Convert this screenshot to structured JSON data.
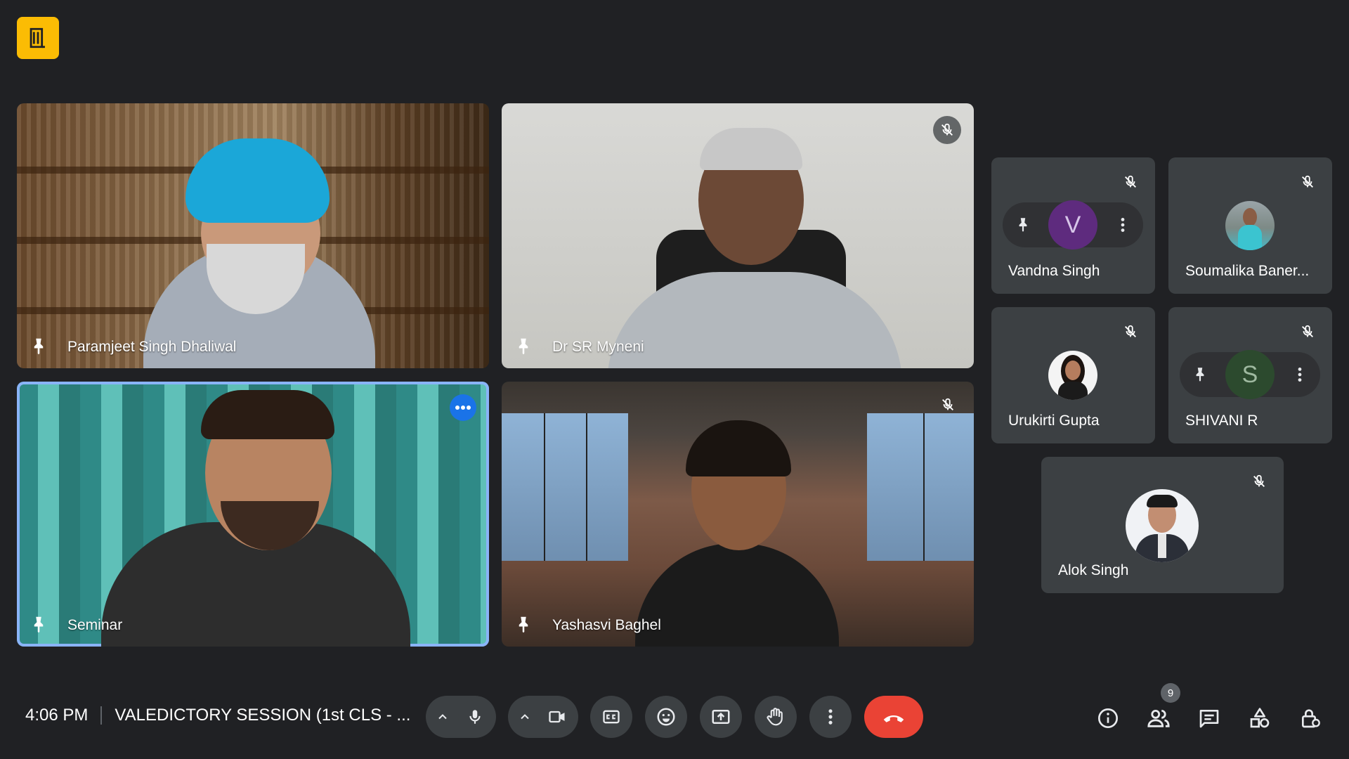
{
  "participants_main": [
    {
      "name": "Paramjeet Singh Dhaliwal"
    },
    {
      "name": "Dr SR Myneni"
    },
    {
      "name": "Seminar"
    },
    {
      "name": "Yashasvi Baghel"
    }
  ],
  "participants_side": [
    {
      "name": "Vandna Singh",
      "initial": "V"
    },
    {
      "name": "Soumalika Baner..."
    },
    {
      "name": "Urukirti Gupta"
    },
    {
      "name": "SHIVANI R",
      "initial": "S"
    },
    {
      "name": "Alok Singh"
    }
  ],
  "footer": {
    "time": "4:06 PM",
    "meeting_title": "VALEDICTORY SESSION (1st CLS - ...",
    "participant_count": "9"
  },
  "colors": {
    "background": "#202124",
    "tile": "#3c4043",
    "end_call": "#ea4335",
    "active_speaker": "#8ab4f8",
    "logo": "#fbbc04",
    "menu_dot": "#1a73e8"
  },
  "icons": [
    "exit-door-icon",
    "microphone-off-icon",
    "pin-icon",
    "more-vert-icon",
    "chevron-up-icon",
    "microphone-icon",
    "camera-icon",
    "captions-icon",
    "emoji-icon",
    "present-icon",
    "raise-hand-icon",
    "end-call-icon",
    "info-icon",
    "people-icon",
    "chat-icon",
    "activities-icon",
    "host-controls-icon"
  ]
}
